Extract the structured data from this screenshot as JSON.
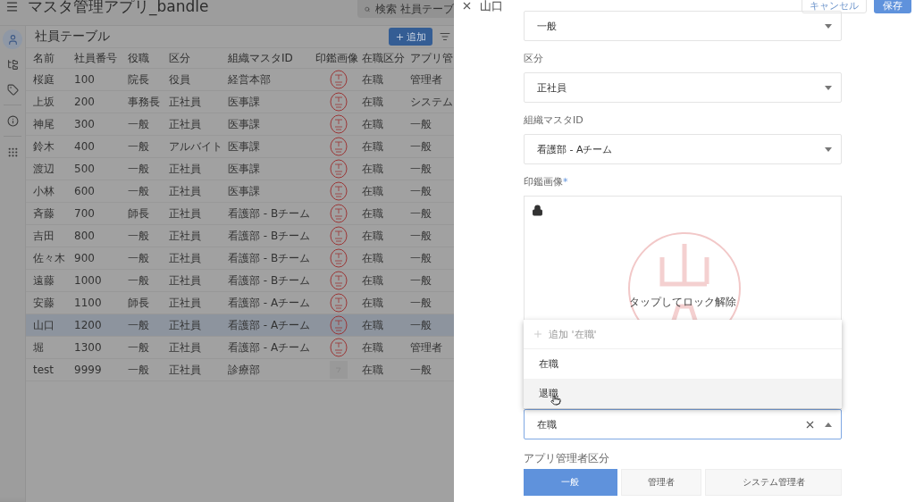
{
  "app": {
    "title": "マスタ管理アプリ_bandle",
    "search_placeholder": "検索 社員テーブ",
    "nav": [
      {
        "selected": true
      },
      {
        "selected": false
      },
      {
        "selected": false
      },
      {
        "selected": false
      },
      {
        "selected": false
      }
    ],
    "table": {
      "title": "社員テーブル",
      "add_button": "追加",
      "columns": [
        "名前",
        "社員番号",
        "役職",
        "区分",
        "組織マスタID",
        "印鑑画像",
        "在職区分",
        "アプリ管"
      ],
      "rows": [
        {
          "cells": [
            "桜庭",
            "100",
            "院長",
            "役員",
            "経営本部"
          ],
          "kind": "stamp",
          "status": "在職",
          "admin": "管理者",
          "selected": false
        },
        {
          "cells": [
            "上坂",
            "200",
            "事務長",
            "正社員",
            "医事課"
          ],
          "kind": "stamp",
          "status": "在職",
          "admin": "システム",
          "selected": false
        },
        {
          "cells": [
            "神尾",
            "300",
            "一般",
            "正社員",
            "医事課"
          ],
          "kind": "stamp",
          "status": "在職",
          "admin": "一般",
          "selected": false
        },
        {
          "cells": [
            "鈴木",
            "400",
            "一般",
            "アルバイト",
            "医事課"
          ],
          "kind": "stamp",
          "status": "在職",
          "admin": "一般",
          "selected": false
        },
        {
          "cells": [
            "渡辺",
            "500",
            "一般",
            "正社員",
            "医事課"
          ],
          "kind": "stamp",
          "status": "在職",
          "admin": "一般",
          "selected": false
        },
        {
          "cells": [
            "小林",
            "600",
            "一般",
            "正社員",
            "医事課"
          ],
          "kind": "stamp",
          "status": "在職",
          "admin": "一般",
          "selected": false
        },
        {
          "cells": [
            "斉藤",
            "700",
            "師長",
            "正社員",
            "看護部 - Bチーム"
          ],
          "kind": "stamp",
          "status": "在職",
          "admin": "一般",
          "selected": false
        },
        {
          "cells": [
            "吉田",
            "800",
            "一般",
            "正社員",
            "看護部 - Bチーム"
          ],
          "kind": "stamp",
          "status": "在職",
          "admin": "一般",
          "selected": false
        },
        {
          "cells": [
            "佐々木",
            "900",
            "一般",
            "正社員",
            "看護部 - Bチーム"
          ],
          "kind": "stamp",
          "status": "在職",
          "admin": "一般",
          "selected": false
        },
        {
          "cells": [
            "遠藤",
            "1000",
            "一般",
            "正社員",
            "看護部 - Bチーム"
          ],
          "kind": "stamp",
          "status": "在職",
          "admin": "一般",
          "selected": false
        },
        {
          "cells": [
            "安藤",
            "1100",
            "師長",
            "正社員",
            "看護部 - Aチーム"
          ],
          "kind": "stamp",
          "status": "在職",
          "admin": "一般",
          "selected": false
        },
        {
          "cells": [
            "山口",
            "1200",
            "一般",
            "正社員",
            "看護部 - Aチーム"
          ],
          "kind": "stamp",
          "status": "在職",
          "admin": "一般",
          "selected": true
        },
        {
          "cells": [
            "堀",
            "1300",
            "一般",
            "正社員",
            "看護部 - Aチーム"
          ],
          "kind": "stamp",
          "status": "在職",
          "admin": "管理者",
          "selected": false
        },
        {
          "cells": [
            "test",
            "9999",
            "一般",
            "正社員",
            "診療部"
          ],
          "kind": "blank",
          "status": "在職",
          "admin": "一般",
          "selected": false
        }
      ]
    }
  },
  "panel": {
    "title": "山口",
    "cancel_button": "キャンセル",
    "save_button": "保存",
    "fields": [
      {
        "kind": "select",
        "value": "一般"
      },
      {
        "kind": "select",
        "label": "区分",
        "value": "正社員"
      },
      {
        "kind": "select",
        "label": "組織マスタID",
        "value": "看護部 - Aチーム"
      },
      {
        "label": "印鑑画像",
        "required_mark": "*",
        "locked": true,
        "hint": "タップしてロック解除"
      },
      {
        "kind": "combo",
        "value": "在職",
        "focused": true,
        "menu": {
          "add_option": "追加 '在職'",
          "options": [
            {
              "label": "在職",
              "selected": false
            },
            {
              "label": "退職",
              "selected": true
            }
          ]
        }
      },
      {
        "kind": "segmented",
        "label": "アプリ管理者区分",
        "options": [
          {
            "label": "一般",
            "selected": true
          },
          {
            "label": "管理者",
            "selected": false
          },
          {
            "label": "システム管理者",
            "selected": false
          }
        ]
      }
    ]
  }
}
